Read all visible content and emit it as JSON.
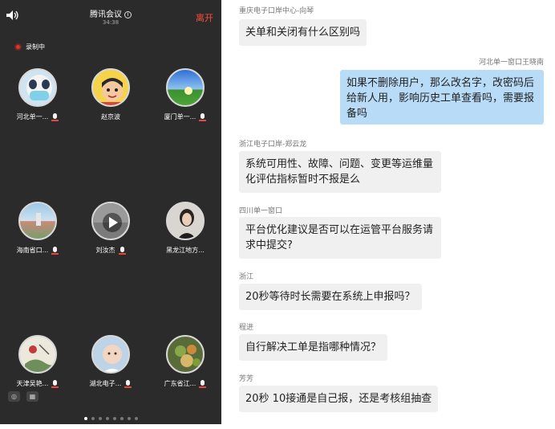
{
  "meeting": {
    "title": "腾讯会议",
    "info_glyph": "i",
    "duration": "34:38",
    "leave_label": "离开",
    "recording_label": "录制中",
    "participants": [
      {
        "name": "河北单一...",
        "mic": true,
        "avatar": "panda-mask-avatar"
      },
      {
        "name": "赵京波",
        "mic": false,
        "avatar": "cartoon-boy-avatar"
      },
      {
        "name": "厦门单一...",
        "mic": true,
        "avatar": "landscape-avatar"
      },
      {
        "name": "海南省口...",
        "mic": true,
        "avatar": "landmark-avatar"
      },
      {
        "name": "刘汝杰",
        "mic": true,
        "avatar": "video-avatar"
      },
      {
        "name": "黑龙江地方...",
        "mic": false,
        "avatar": "woman-portrait-avatar"
      },
      {
        "name": "天津吴艳...",
        "mic": true,
        "avatar": "painting-avatar"
      },
      {
        "name": "湖北电子...",
        "mic": true,
        "avatar": "baby-avatar"
      },
      {
        "name": "广东省江...",
        "mic": true,
        "avatar": "food-avatar"
      }
    ],
    "bottom_icons": [
      "globe-icon",
      "keyboard-icon"
    ],
    "page_count": 8,
    "current_page": 1
  },
  "chat": {
    "messages": [
      {
        "sender": "重庆电子口岸中心-向琴",
        "text": "关单和关闭有什么区别吗",
        "self": false
      },
      {
        "sender": "河北单一窗口王晓南",
        "text": "如果不删除用户，那么改名字，改密码后给新人用，影响历史工单查看吗，需要报备吗",
        "self": true
      },
      {
        "sender": "浙江电子口岸-郑云龙",
        "text": "系统可用性、故障、问题、变更等运维量化评估指标暂时不报是么",
        "self": false
      },
      {
        "sender": "四川单一窗口",
        "text": "平台优化建议是否可以在运管平台服务请求中提交?",
        "self": false
      },
      {
        "sender": "浙江",
        "text": "20秒等待时长需要在系统上申报吗？",
        "self": false
      },
      {
        "sender": "程进",
        "text": "自行解决工单是指哪种情况？",
        "self": false
      },
      {
        "sender": "芳芳",
        "text": "20秒 10接通是自己报，还是考核组抽查",
        "self": false
      }
    ]
  },
  "colors": {
    "panel_bg": "#2b2b2b",
    "leave_red": "#ff4c3b",
    "self_bubble": "#b8dcf7",
    "other_bubble": "#f0f0f0"
  }
}
